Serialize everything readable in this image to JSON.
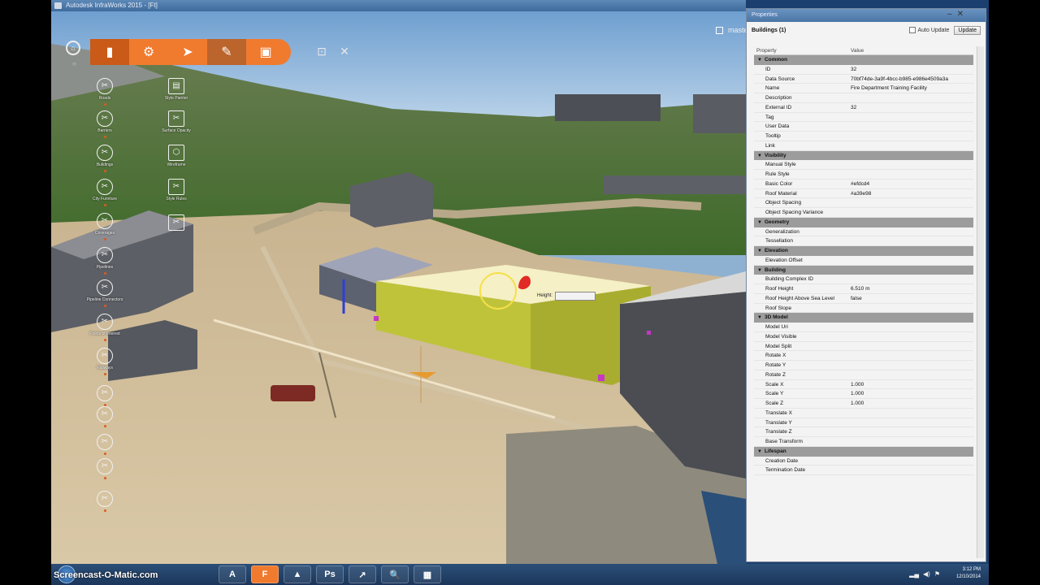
{
  "window": {
    "title": "Autodesk InfraWorks 2015 - [Ft]"
  },
  "branch": {
    "icon": "branch-icon",
    "label": "master"
  },
  "toolbar": {
    "buttons": [
      {
        "name": "manage-button",
        "glyph": "▮"
      },
      {
        "name": "settings-button",
        "glyph": "⚙"
      },
      {
        "name": "select-button",
        "glyph": "➤"
      },
      {
        "name": "create-button",
        "glyph": "✎"
      },
      {
        "name": "layers-button",
        "glyph": "▣"
      }
    ],
    "extra": [
      {
        "name": "bookmark-button",
        "glyph": "⊡"
      },
      {
        "name": "close-tools-button",
        "glyph": "✕"
      }
    ]
  },
  "tools_left": [
    {
      "label": "Roads",
      "glyph": "✂"
    },
    {
      "label": "Barriers",
      "glyph": "✂"
    },
    {
      "label": "Buildings",
      "glyph": "✂"
    },
    {
      "label": "City Furniture",
      "glyph": "✂"
    },
    {
      "label": "Coverages",
      "glyph": "✂"
    },
    {
      "label": "Pipelines",
      "glyph": "✂"
    },
    {
      "label": "Pipeline Connectors",
      "glyph": "✂"
    },
    {
      "label": "Points of Interest",
      "glyph": "✂"
    },
    {
      "label": "Railways",
      "glyph": "✂"
    },
    {
      "label": "",
      "glyph": "✂"
    },
    {
      "label": "",
      "glyph": "✂"
    },
    {
      "label": "",
      "glyph": "✂"
    },
    {
      "label": "",
      "glyph": "✂"
    },
    {
      "label": "",
      "glyph": "✂"
    }
  ],
  "tools_right": [
    {
      "label": "Style Painter",
      "glyph": "▤"
    },
    {
      "label": "Surface Opacity",
      "glyph": "✂"
    },
    {
      "label": "Wireframe",
      "glyph": "⬡"
    },
    {
      "label": "Style Rules",
      "glyph": "✂"
    },
    {
      "label": "",
      "glyph": "✂"
    }
  ],
  "height_editor": {
    "label": "Height:",
    "value": ""
  },
  "statusbar": {
    "text": ""
  },
  "properties": {
    "panel_title": "Properties",
    "selection": "Buildings (1)",
    "auto_update": "Auto Update",
    "update_button": "Update",
    "col_property": "Property",
    "col_value": "Value",
    "categories": [
      {
        "name": "Common",
        "props": [
          {
            "k": "ID",
            "v": "32"
          },
          {
            "k": "Data Source",
            "v": "70bf74de-3a9f-4bcc-b985-e986e4509a3a"
          },
          {
            "k": "Name",
            "v": "Fire Department Training Facility"
          },
          {
            "k": "Description",
            "v": ""
          },
          {
            "k": "External ID",
            "v": "32"
          },
          {
            "k": "Tag",
            "v": ""
          },
          {
            "k": "User Data",
            "v": ""
          },
          {
            "k": "Tooltip",
            "v": ""
          },
          {
            "k": "Link",
            "v": ""
          }
        ]
      },
      {
        "name": "Visibility",
        "props": [
          {
            "k": "Manual Style",
            "v": ""
          },
          {
            "k": "Rule Style",
            "v": ""
          },
          {
            "k": "Basic Color",
            "v": "#efdcd4"
          },
          {
            "k": "Roof Material",
            "v": "#a39e98"
          },
          {
            "k": "Object Spacing",
            "v": ""
          },
          {
            "k": "Object Spacing Variance",
            "v": ""
          }
        ]
      },
      {
        "name": "Geometry",
        "props": [
          {
            "k": "Generalization",
            "v": ""
          },
          {
            "k": "Tessellation",
            "v": ""
          }
        ]
      },
      {
        "name": "Elevation",
        "props": [
          {
            "k": "Elevation Offset",
            "v": ""
          }
        ]
      },
      {
        "name": "Building",
        "props": [
          {
            "k": "Building Complex ID",
            "v": ""
          },
          {
            "k": "Roof Height",
            "v": "6.510 m"
          },
          {
            "k": "Roof Height Above Sea Level",
            "v": "false"
          },
          {
            "k": "Roof Slope",
            "v": ""
          }
        ]
      },
      {
        "name": "3D Model",
        "props": [
          {
            "k": "Model Uri",
            "v": ""
          },
          {
            "k": "Model Visible",
            "v": ""
          },
          {
            "k": "Model Split",
            "v": ""
          },
          {
            "k": "Rotate X",
            "v": ""
          },
          {
            "k": "Rotate Y",
            "v": ""
          },
          {
            "k": "Rotate Z",
            "v": ""
          },
          {
            "k": "Scale X",
            "v": "1.000"
          },
          {
            "k": "Scale Y",
            "v": "1.000"
          },
          {
            "k": "Scale Z",
            "v": "1.000"
          },
          {
            "k": "Translate X",
            "v": ""
          },
          {
            "k": "Translate Y",
            "v": ""
          },
          {
            "k": "Translate Z",
            "v": ""
          },
          {
            "k": "Base Transform",
            "v": ""
          }
        ]
      },
      {
        "name": "Lifespan",
        "props": [
          {
            "k": "Creation Date",
            "v": ""
          },
          {
            "k": "Termination Date",
            "v": ""
          }
        ]
      }
    ]
  },
  "taskbar": {
    "apps": [
      {
        "name": "autodesk-app",
        "glyph": "A"
      },
      {
        "name": "infraworks-app",
        "glyph": "F",
        "color": "#f07a2e"
      },
      {
        "name": "sketch-app",
        "glyph": "▲"
      },
      {
        "name": "photoshop-app",
        "glyph": "Ps"
      },
      {
        "name": "chart-app",
        "glyph": "↗"
      },
      {
        "name": "search-app",
        "glyph": "🔍"
      },
      {
        "name": "video-app",
        "glyph": "▦"
      }
    ],
    "watermark": "Screencast-O-Matic.com",
    "clock_time": "3:12 PM",
    "clock_date": "12/10/2014"
  },
  "colors": {
    "accent": "#f07a2e",
    "selection": "#cfd23a",
    "panel": "#f3f3f3"
  }
}
